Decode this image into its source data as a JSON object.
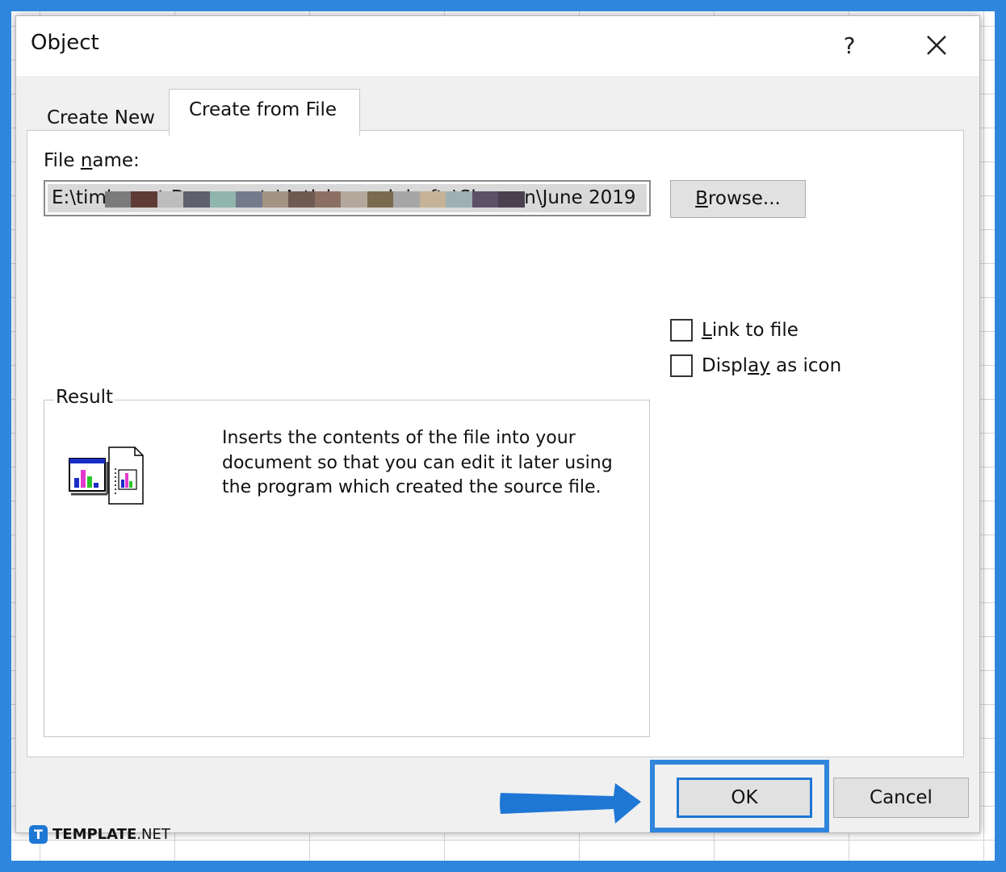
{
  "dialog": {
    "title": "Object",
    "help_label": "?",
    "tabs": [
      {
        "label": "Create New",
        "active": false
      },
      {
        "label": "Create from File",
        "active": true
      }
    ],
    "file_name_label": {
      "pre": "File ",
      "accel": "n",
      "post": "ame:"
    },
    "file_name_value": "E:\\timkamat Documents\\Articles and drafts\\Shravan\\June 2019",
    "browse_button": {
      "accel": "B",
      "rest": "rowse..."
    },
    "link_to_file": {
      "accel": "L",
      "rest": "ink to file",
      "checked": false
    },
    "display_as_icon": {
      "pre": "Displ",
      "accel": "a",
      "mid": "y",
      "post": " as icon",
      "checked": false
    },
    "result": {
      "legend": "Result",
      "description": "Inserts the contents of the file into your document so that you can edit it later using the program which created the source file."
    },
    "ok_button": "OK",
    "cancel_button": "Cancel"
  },
  "watermark": {
    "logo_letter": "T",
    "brand_bold": "TEMPLATE",
    "brand_suffix": ".NET"
  },
  "colors": {
    "highlight": "#2f86dd",
    "accent": "#1e77d4"
  }
}
